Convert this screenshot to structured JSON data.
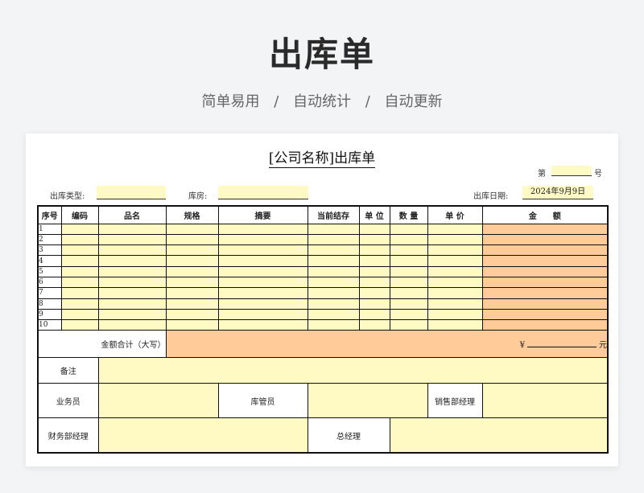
{
  "hero": {
    "title": "出库单",
    "features": [
      "简单易用",
      "自动统计",
      "自动更新"
    ],
    "separator": "/"
  },
  "form": {
    "title": "[公司名称]出库单",
    "number_prefix": "第",
    "number_suffix": "号",
    "type_label": "出库类型:",
    "warehouse_label": "库房:",
    "date_label": "出库日期:",
    "date_value": "2024年9月9日",
    "columns": [
      "序号",
      "编码",
      "品名",
      "规格",
      "摘要",
      "当前结存",
      "单 位",
      "数 量",
      "单 价",
      "金　　额"
    ],
    "rows": [
      "1",
      "2",
      "3",
      "4",
      "5",
      "6",
      "7",
      "8",
      "9",
      "10"
    ],
    "total_label": "金额合计（大写）",
    "yen_symbol": "¥",
    "yuan_suffix": "元",
    "remarks_label": "备注",
    "salesperson_label": "业务员",
    "keeper_label": "库管员",
    "sales_manager_label": "销售部经理",
    "finance_manager_label": "财务部经理",
    "general_manager_label": "总经理"
  },
  "colors": {
    "input_fill": "#fff9c4",
    "amount_fill": "#ffcc99"
  }
}
